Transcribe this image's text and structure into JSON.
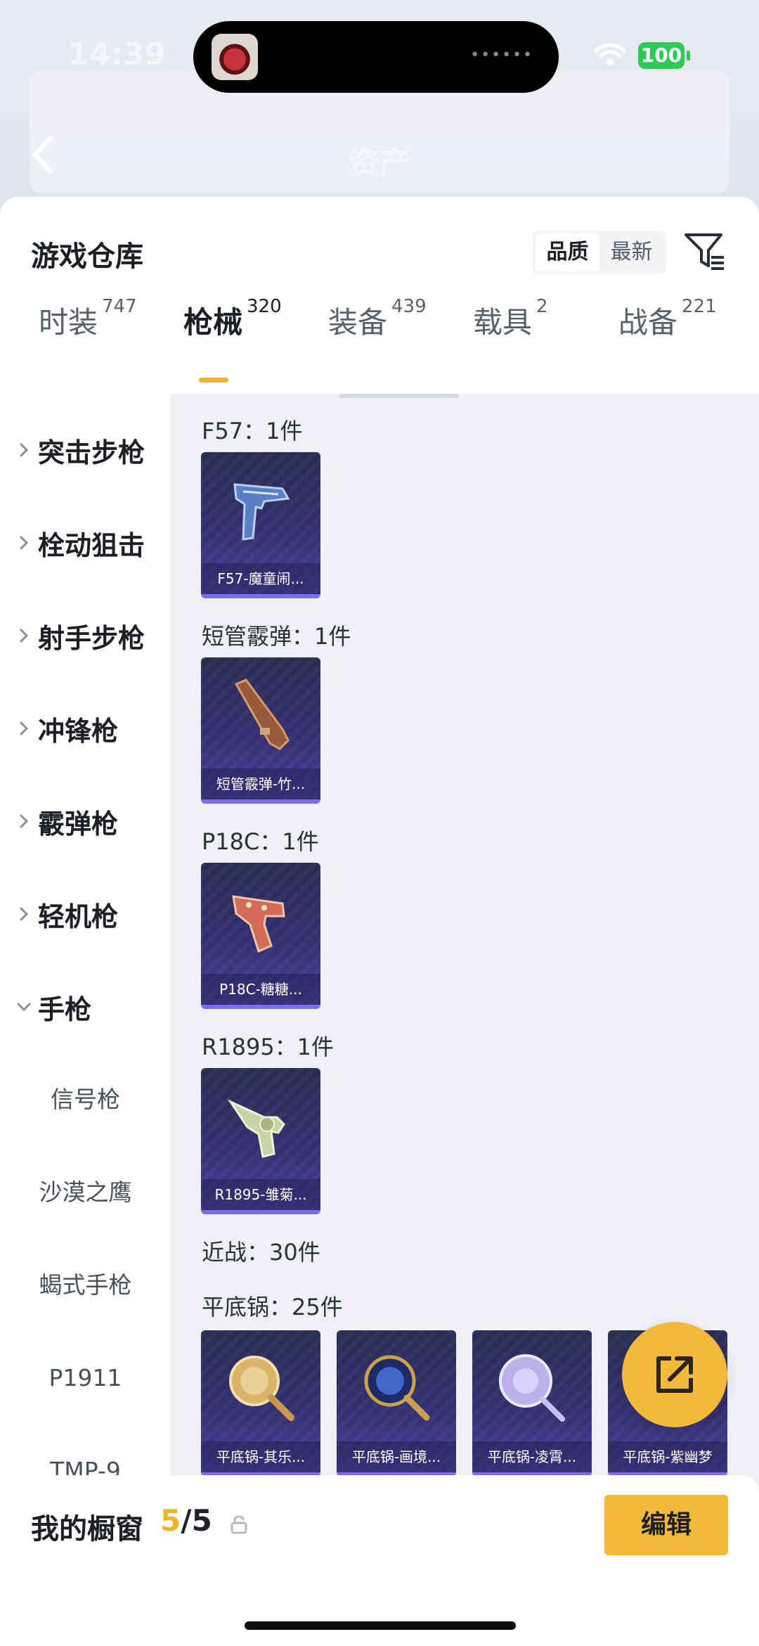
{
  "status_bar": {
    "time": "14:39",
    "battery": "100",
    "icons": [
      "wifi-icon",
      "battery-icon"
    ]
  },
  "header": {
    "title": "资产",
    "back_icon": "back-arrow-icon"
  },
  "sheet": {
    "title": "游戏仓库",
    "sort_options": [
      {
        "label": "品质",
        "active": true
      },
      {
        "label": "最新",
        "active": false
      }
    ],
    "filter_icon": "filter-icon"
  },
  "tabs": [
    {
      "label": "时装",
      "count": "747",
      "active": false
    },
    {
      "label": "枪械",
      "count": "320",
      "active": true
    },
    {
      "label": "装备",
      "count": "439",
      "active": false
    },
    {
      "label": "载具",
      "count": "2",
      "active": false
    },
    {
      "label": "战备",
      "count": "221",
      "active": false
    }
  ],
  "categories": [
    {
      "label": "突击步枪",
      "expanded": false
    },
    {
      "label": "栓动狙击",
      "expanded": false
    },
    {
      "label": "射手步枪",
      "expanded": false
    },
    {
      "label": "冲锋枪",
      "expanded": false
    },
    {
      "label": "霰弹枪",
      "expanded": false
    },
    {
      "label": "轻机枪",
      "expanded": false
    },
    {
      "label": "手枪",
      "expanded": true
    }
  ],
  "subcategories": [
    "信号枪",
    "沙漠之鹰",
    "蝎式手枪",
    "P1911",
    "TMP-9"
  ],
  "groups": [
    {
      "label": "F57：1件",
      "items": [
        {
          "caption": "F57-魔童闹...",
          "icon": "pistol-icon"
        }
      ]
    },
    {
      "label": "短管霰弹：1件",
      "items": [
        {
          "caption": "短管霰弹-竹...",
          "icon": "shotgun-icon"
        }
      ]
    },
    {
      "label": "P18C：1件",
      "items": [
        {
          "caption": "P18C-糖糖...",
          "icon": "pistol-icon"
        }
      ]
    },
    {
      "label": "R1895：1件",
      "items": [
        {
          "caption": "R1895-雏菊...",
          "icon": "revolver-icon"
        }
      ]
    },
    {
      "label": "近战：30件",
      "items": []
    },
    {
      "label": "平底锅：25件",
      "items": [
        {
          "caption": "平底锅-其乐...",
          "icon": "pan-icon"
        },
        {
          "caption": "平底锅-画境...",
          "icon": "pan-icon"
        },
        {
          "caption": "平底锅-凌霄...",
          "icon": "pan-icon"
        },
        {
          "caption": "平底锅-紫幽梦",
          "icon": "pan-icon"
        }
      ]
    }
  ],
  "fab": {
    "icon": "share-icon"
  },
  "bottom_bar": {
    "label": "我的橱窗",
    "count_current": "5",
    "count_total": "/5",
    "lock_icon": "lock-icon",
    "edit_label": "编辑"
  },
  "colors": {
    "accent": "#f2b93a",
    "card_bg": "#352f70",
    "card_border": "#7b6cf0",
    "content_bg": "#eef0f4"
  }
}
